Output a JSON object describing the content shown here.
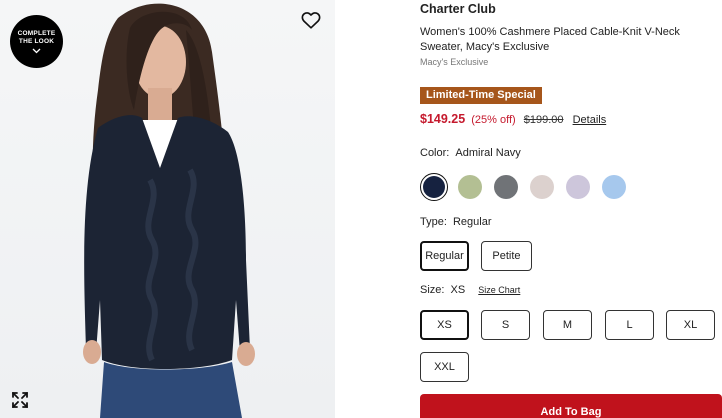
{
  "media": {
    "complete_look_line1": "COMPLETE",
    "complete_look_line2": "THE LOOK"
  },
  "product": {
    "brand": "Charter Club",
    "name": "Women's 100% Cashmere Placed Cable-Knit V-Neck Sweater, Macy's Exclusive",
    "seller": "Macy's Exclusive",
    "promo_badge": "Limited-Time Special",
    "sale_price": "$149.25",
    "percent_off": "(25% off)",
    "original_price": "$199.00",
    "details_link": "Details"
  },
  "color": {
    "label": "Color:",
    "selected": "Admiral Navy",
    "swatches": [
      {
        "hex": "#162240",
        "selected": true
      },
      {
        "hex": "#b3bf93",
        "selected": false
      },
      {
        "hex": "#707377",
        "selected": false
      },
      {
        "hex": "#dcd1ce",
        "selected": false
      },
      {
        "hex": "#cdc6db",
        "selected": false
      },
      {
        "hex": "#a6c8ed",
        "selected": false
      }
    ]
  },
  "type": {
    "label": "Type:",
    "selected": "Regular",
    "options": [
      "Regular",
      "Petite"
    ]
  },
  "size": {
    "label": "Size:",
    "selected": "XS",
    "chart_link": "Size Chart",
    "options": [
      "XS",
      "S",
      "M",
      "L",
      "XL",
      "XXL"
    ]
  },
  "cta": {
    "add_to_bag": "Add To Bag",
    "color": "#c0121c"
  },
  "theme": {
    "sale_red": "#c5192d",
    "promo_badge_bg": "#a6561b"
  }
}
